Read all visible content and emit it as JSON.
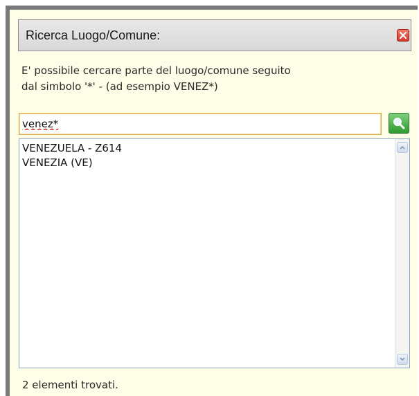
{
  "dialog": {
    "title": "Ricerca Luogo/Comune:"
  },
  "hint": {
    "line1": "E' possibile cercare parte del luogo/comune seguito",
    "line2": "dal simbolo '*' - (ad esempio VENEZ*)"
  },
  "search": {
    "value": "venez*",
    "button_icon": "magnifier-icon"
  },
  "results": {
    "items": [
      {
        "label": "VENEZUELA - Z614"
      },
      {
        "label": "VENEZIA (VE)"
      }
    ]
  },
  "status": {
    "text": "2 elementi trovati."
  },
  "colors": {
    "panel_bg": "#fefde8",
    "close_red": "#d23a2a",
    "search_green": "#2f9a2f"
  }
}
